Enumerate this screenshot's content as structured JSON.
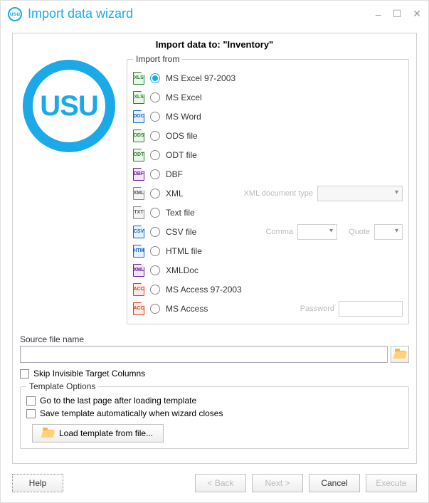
{
  "window": {
    "title": "Import data wizard",
    "minimize": "–",
    "maximize": "☐",
    "close": "✕"
  },
  "header": {
    "title": "Import data to: \"Inventory\""
  },
  "logo_text": "USU",
  "import_from": {
    "legend": "Import from",
    "xml_doc_type_label": "XML document type",
    "comma_label": "Comma",
    "quote_label": "Quote",
    "password_label": "Password",
    "options": [
      {
        "label": "MS Excel 97-2003",
        "checked": true,
        "icon": "XLS",
        "iconClass": "fi-xls"
      },
      {
        "label": "MS Excel",
        "checked": false,
        "icon": "XLSX",
        "iconClass": "fi-xlsx"
      },
      {
        "label": "MS Word",
        "checked": false,
        "icon": "DOCX",
        "iconClass": "fi-doc"
      },
      {
        "label": "ODS file",
        "checked": false,
        "icon": "ODS",
        "iconClass": "fi-ods"
      },
      {
        "label": "ODT file",
        "checked": false,
        "icon": "ODT",
        "iconClass": "fi-odt"
      },
      {
        "label": "DBF",
        "checked": false,
        "icon": "DBF",
        "iconClass": "fi-dbf"
      },
      {
        "label": "XML",
        "checked": false,
        "icon": "XML",
        "iconClass": "fi-xml",
        "extra": "xml"
      },
      {
        "label": "Text file",
        "checked": false,
        "icon": "TXT",
        "iconClass": "fi-txt"
      },
      {
        "label": "CSV file",
        "checked": false,
        "icon": "CSV",
        "iconClass": "fi-csv",
        "extra": "csv"
      },
      {
        "label": "HTML file",
        "checked": false,
        "icon": "HTM",
        "iconClass": "fi-htm"
      },
      {
        "label": "XMLDoc",
        "checked": false,
        "icon": "XMLD",
        "iconClass": "fi-xmld"
      },
      {
        "label": "MS Access 97-2003",
        "checked": false,
        "icon": "ACC",
        "iconClass": "fi-acc"
      },
      {
        "label": "MS Access",
        "checked": false,
        "icon": "ACC",
        "iconClass": "fi-acc",
        "extra": "password"
      }
    ]
  },
  "source": {
    "label": "Source file name",
    "value": ""
  },
  "skip_invisible": "Skip Invisible Target Columns",
  "template": {
    "legend": "Template Options",
    "goto_last": "Go to the last page after loading template",
    "auto_save": "Save template automatically when wizard closes",
    "load_btn": "Load template from file..."
  },
  "footer": {
    "help": "Help",
    "back": "< Back",
    "next": "Next >",
    "cancel": "Cancel",
    "execute": "Execute"
  }
}
